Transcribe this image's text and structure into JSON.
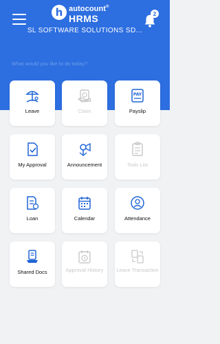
{
  "header": {
    "brand": "autocount",
    "brand_mark": "®",
    "product": "HRMS",
    "logo_letter": "h",
    "company": "SL SOFTWARE SOLUTIONS SD...",
    "notification_count": "2"
  },
  "prompt": "What would you like to do today?",
  "colors": {
    "accent": "#2d6ee0",
    "disabled": "#c9c9c9"
  },
  "tiles": [
    {
      "label": "Leave",
      "icon": "leave-icon",
      "enabled": true
    },
    {
      "label": "Claim",
      "icon": "claim-icon",
      "enabled": false
    },
    {
      "label": "Payslip",
      "icon": "payslip-icon",
      "enabled": true
    },
    {
      "label": "My Approval",
      "icon": "approval-icon",
      "enabled": true
    },
    {
      "label": "Announcement",
      "icon": "announcement-icon",
      "enabled": true
    },
    {
      "label": "Todo List",
      "icon": "todo-list-icon",
      "enabled": false
    },
    {
      "label": "Loan",
      "icon": "loan-icon",
      "enabled": true
    },
    {
      "label": "Calendar",
      "icon": "calendar-icon",
      "enabled": true
    },
    {
      "label": "Attendance",
      "icon": "attendance-icon",
      "enabled": true
    },
    {
      "label": "Shared Docs",
      "icon": "shared-docs-icon",
      "enabled": true
    },
    {
      "label": "Approval History",
      "icon": "approval-history-icon",
      "enabled": false
    },
    {
      "label": "Leave Transaction",
      "icon": "leave-transaction-icon",
      "enabled": false
    }
  ]
}
